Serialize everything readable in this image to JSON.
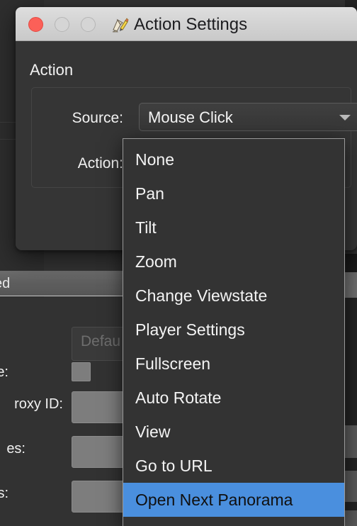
{
  "background_window": {
    "header_label": "ed",
    "default_placeholder": "Defau",
    "rows": [
      {
        "label": "e:",
        "type": "checkbox"
      },
      {
        "label": "roxy ID:",
        "type": "text"
      },
      {
        "label": "es:",
        "type": "text"
      },
      {
        "label": "s:",
        "type": "text"
      }
    ],
    "accent_color": "#4a8fde"
  },
  "dialog": {
    "title": "Action Settings",
    "icon": "action-settings-icon",
    "traffic_lights": {
      "close_label": "close",
      "minimize_label": "minimize",
      "maximize_label": "maximize",
      "close_color": "#fc6058",
      "inactive_color": "#d5d5d5"
    },
    "section_title": "Action",
    "fields": [
      {
        "label": "Source:",
        "value": "Mouse Click"
      },
      {
        "label": "Action:",
        "value": ""
      }
    ]
  },
  "dropdown_menu": {
    "open": true,
    "selected": "Open Next Panorama",
    "highlight_color": "#4a8fde",
    "items": [
      {
        "label": "None"
      },
      {
        "label": "Pan"
      },
      {
        "label": "Tilt"
      },
      {
        "label": "Zoom"
      },
      {
        "label": "Change Viewstate"
      },
      {
        "label": "Player Settings"
      },
      {
        "label": "Fullscreen"
      },
      {
        "label": "Auto Rotate"
      },
      {
        "label": "View"
      },
      {
        "label": "Go to URL"
      },
      {
        "label": "Open Next Panorama"
      }
    ]
  }
}
